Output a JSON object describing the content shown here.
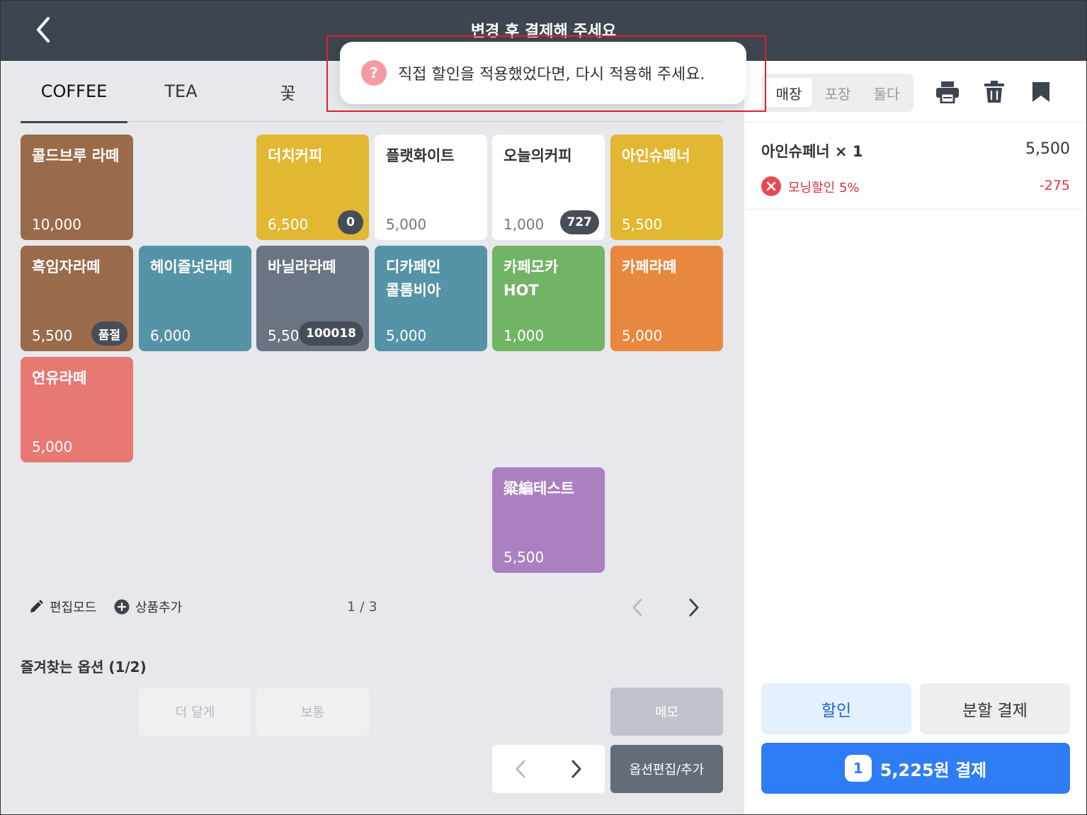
{
  "header": {
    "title": "변경 후 결제해 주세요"
  },
  "toast": {
    "message": "직접 할인을 적용했었다면, 다시 적용해 주세요."
  },
  "tabs": [
    {
      "label": "COFFEE",
      "active": true
    },
    {
      "label": "TEA",
      "active": false
    },
    {
      "label": "꽃",
      "active": false
    }
  ],
  "products": [
    {
      "name": "콜드브루 라떼",
      "price": "10,000",
      "color": "#9a6b4a",
      "badge": ""
    },
    {
      "name": "더치커피",
      "price": "6,500",
      "color": "#e2b731",
      "badge": "0"
    },
    {
      "name": "플랫화이트",
      "price": "5,000",
      "color": "#ffffff",
      "badge": ""
    },
    {
      "name": "오늘의커피",
      "price": "1,000",
      "color": "#ffffff",
      "badge": "727"
    },
    {
      "name": "아인슈페너",
      "price": "5,500",
      "color": "#e2b731",
      "badge": ""
    },
    {
      "name": "흑임자라떼",
      "price": "5,500",
      "color": "#9a6b4a",
      "badge": "품절"
    },
    {
      "name": "헤이즐넛라떼",
      "price": "6,000",
      "color": "#5593a6",
      "badge": ""
    },
    {
      "name": "바닐라라떼",
      "price": "5,500",
      "color": "#6b7482",
      "badge": "100018"
    },
    {
      "name": "디카페인\n콜롬비아",
      "price": "5,000",
      "color": "#5593a6",
      "badge": ""
    },
    {
      "name": "카페모카\nHOT",
      "price": "1,000",
      "color": "#72b465",
      "badge": ""
    },
    {
      "name": "카페라떼",
      "price": "5,000",
      "color": "#e8883e",
      "badge": ""
    },
    {
      "name": "연유라떼",
      "price": "5,000",
      "color": "#e87872",
      "badge": ""
    },
    {
      "name": "粱編테스트",
      "price": "5,500",
      "color": "#ab80c0",
      "badge": ""
    }
  ],
  "toolbar": {
    "edit_mode": "편집모드",
    "add_product": "상품추가",
    "page": "1 / 3"
  },
  "favorites": {
    "title": "즐겨찾는 옵션 (1/2)",
    "options": [
      "더 달게",
      "보통"
    ],
    "memo": "메모",
    "edit_options": "옵션편집/추가"
  },
  "order": {
    "segments": [
      {
        "label": "매장",
        "active": true
      },
      {
        "label": "포장",
        "active": false
      },
      {
        "label": "둘다",
        "active": false
      }
    ],
    "item_name": "아인슈페너 × 1",
    "item_price": "5,500",
    "discount_name": "모닝할인 5%",
    "discount_amount": "-275",
    "discount_button": "할인",
    "split_button": "분할 결제",
    "pay_count": "1",
    "pay_label": "5,225원 결제"
  },
  "icons": [
    "back-icon",
    "print-icon",
    "trash-icon",
    "bookmark-icon",
    "pencil-icon",
    "plus-circle-icon",
    "question-icon",
    "close-icon"
  ],
  "colors": {
    "header": "#3d4550",
    "accent": "#2f7df4",
    "danger": "#e0323f"
  }
}
